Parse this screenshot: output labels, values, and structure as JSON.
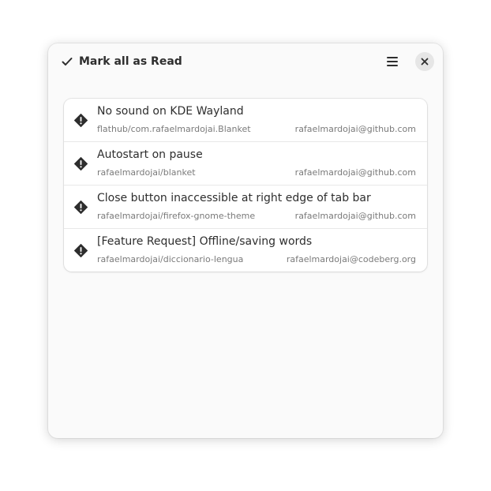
{
  "header": {
    "mark_all_label": "Mark all as Read",
    "mark_all_icon": "check-icon",
    "menu_icon": "hamburger-menu-icon",
    "close_icon": "close-icon"
  },
  "notifications": [
    {
      "title": "No sound on KDE Wayland",
      "repo": "flathub/com.rafaelmardojai.Blanket",
      "account": "rafaelmardojai@github.com",
      "icon": "issue-alert-icon"
    },
    {
      "title": "Autostart on pause",
      "repo": "rafaelmardojai/blanket",
      "account": "rafaelmardojai@github.com",
      "icon": "issue-alert-icon"
    },
    {
      "title": "Close button inaccessible at right edge of tab bar",
      "repo": "rafaelmardojai/firefox-gnome-theme",
      "account": "rafaelmardojai@github.com",
      "icon": "issue-alert-icon"
    },
    {
      "title": "[Feature Request] Offline/saving words",
      "repo": "rafaelmardojai/diccionario-lengua",
      "account": "rafaelmardojai@codeberg.org",
      "icon": "issue-alert-icon"
    }
  ]
}
